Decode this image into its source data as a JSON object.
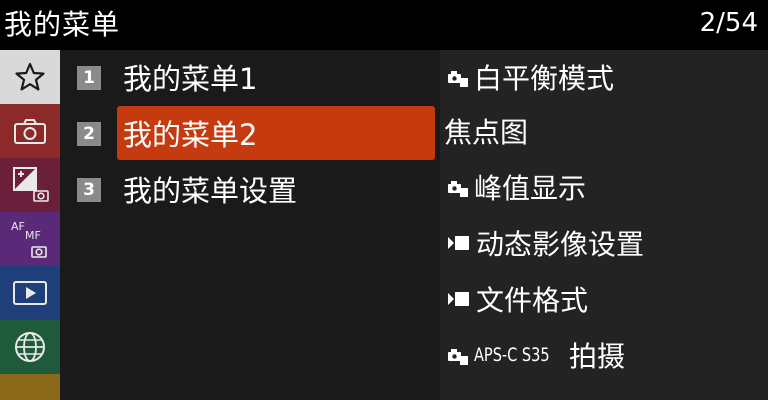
{
  "header": {
    "title": "我的菜单",
    "page": "2/54"
  },
  "sidebar": {
    "tabs": [
      {
        "icon": "star-icon",
        "active": true
      },
      {
        "icon": "camera-icon",
        "color": "#8c2a2a"
      },
      {
        "icon": "exposure-camera-icon",
        "color": "#6b1f3a"
      },
      {
        "icon": "af-mf-icon",
        "color": "#5a2a78",
        "text_af": "AF",
        "text_mf": "MF"
      },
      {
        "icon": "playback-icon",
        "color": "#1f3f7a"
      },
      {
        "icon": "globe-icon",
        "color": "#1f5a3a"
      }
    ]
  },
  "menu": {
    "items": [
      {
        "num": "1",
        "label": "我的菜单1",
        "selected": false
      },
      {
        "num": "2",
        "label": "我的菜单2",
        "selected": true
      },
      {
        "num": "3",
        "label": "我的菜单设置",
        "selected": false
      }
    ]
  },
  "preview": {
    "items": [
      {
        "icon": "photo-mode-icon",
        "label": "白平衡模式"
      },
      {
        "icon": "",
        "label": "焦点图"
      },
      {
        "icon": "photo-mode-icon",
        "label": "峰值显示"
      },
      {
        "icon": "movie-mode-icon",
        "label": "动态影像设置"
      },
      {
        "icon": "movie-mode-icon",
        "label": "文件格式"
      },
      {
        "icon": "photo-mode-icon",
        "prefix": "APS-C S35",
        "label": "拍摄"
      }
    ]
  }
}
